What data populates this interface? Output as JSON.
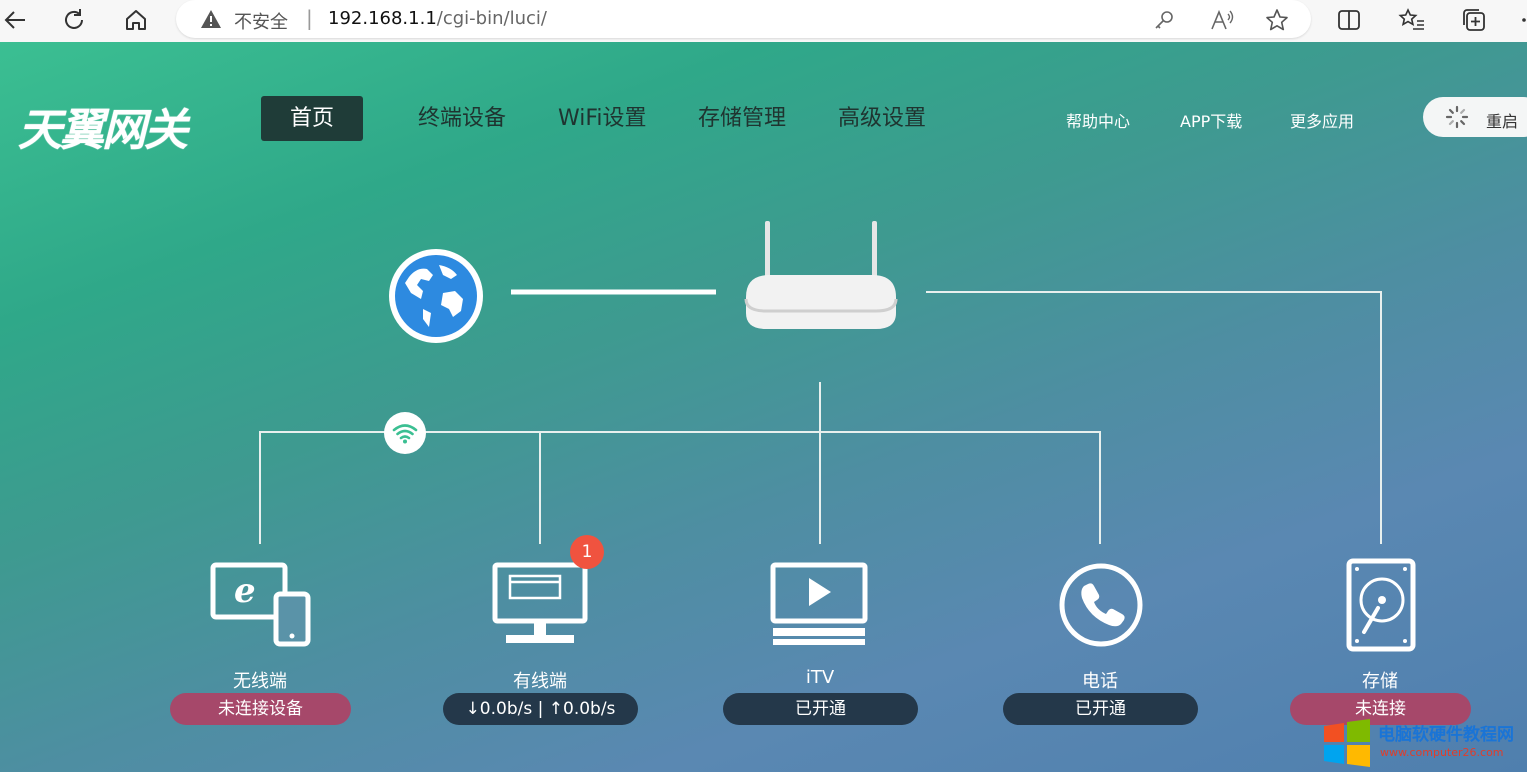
{
  "browser": {
    "security_label": "不安全",
    "url_host": "192.168.1.1",
    "url_path": "/cgi-bin/luci/"
  },
  "header": {
    "logo_text": "天翼网关",
    "nav": [
      {
        "label": "首页",
        "active": true
      },
      {
        "label": "终端设备"
      },
      {
        "label": "WiFi设置"
      },
      {
        "label": "存储管理"
      },
      {
        "label": "高级设置"
      }
    ],
    "links": {
      "help": "帮助中心",
      "app": "APP下载",
      "more": "更多应用"
    },
    "restart_label": "重启"
  },
  "topology": {
    "devices": {
      "wireless": {
        "label": "无线端",
        "status": "未连接设备"
      },
      "wired": {
        "label": "有线端",
        "status": "↓0.0b/s | ↑0.0b/s",
        "badge": "1"
      },
      "itv": {
        "label": "iTV",
        "status": "已开通"
      },
      "phone": {
        "label": "电话",
        "status": "已开通"
      },
      "storage": {
        "label": "存储",
        "status": "未连接"
      }
    }
  },
  "colors": {
    "nav_active_bg": "#1f3c38",
    "status_red": "#a6486a",
    "status_dark": "#24384a",
    "badge": "#f0533f"
  },
  "watermark": {
    "title": "电脑软硬件教程网",
    "url": "www.computer26.com"
  }
}
